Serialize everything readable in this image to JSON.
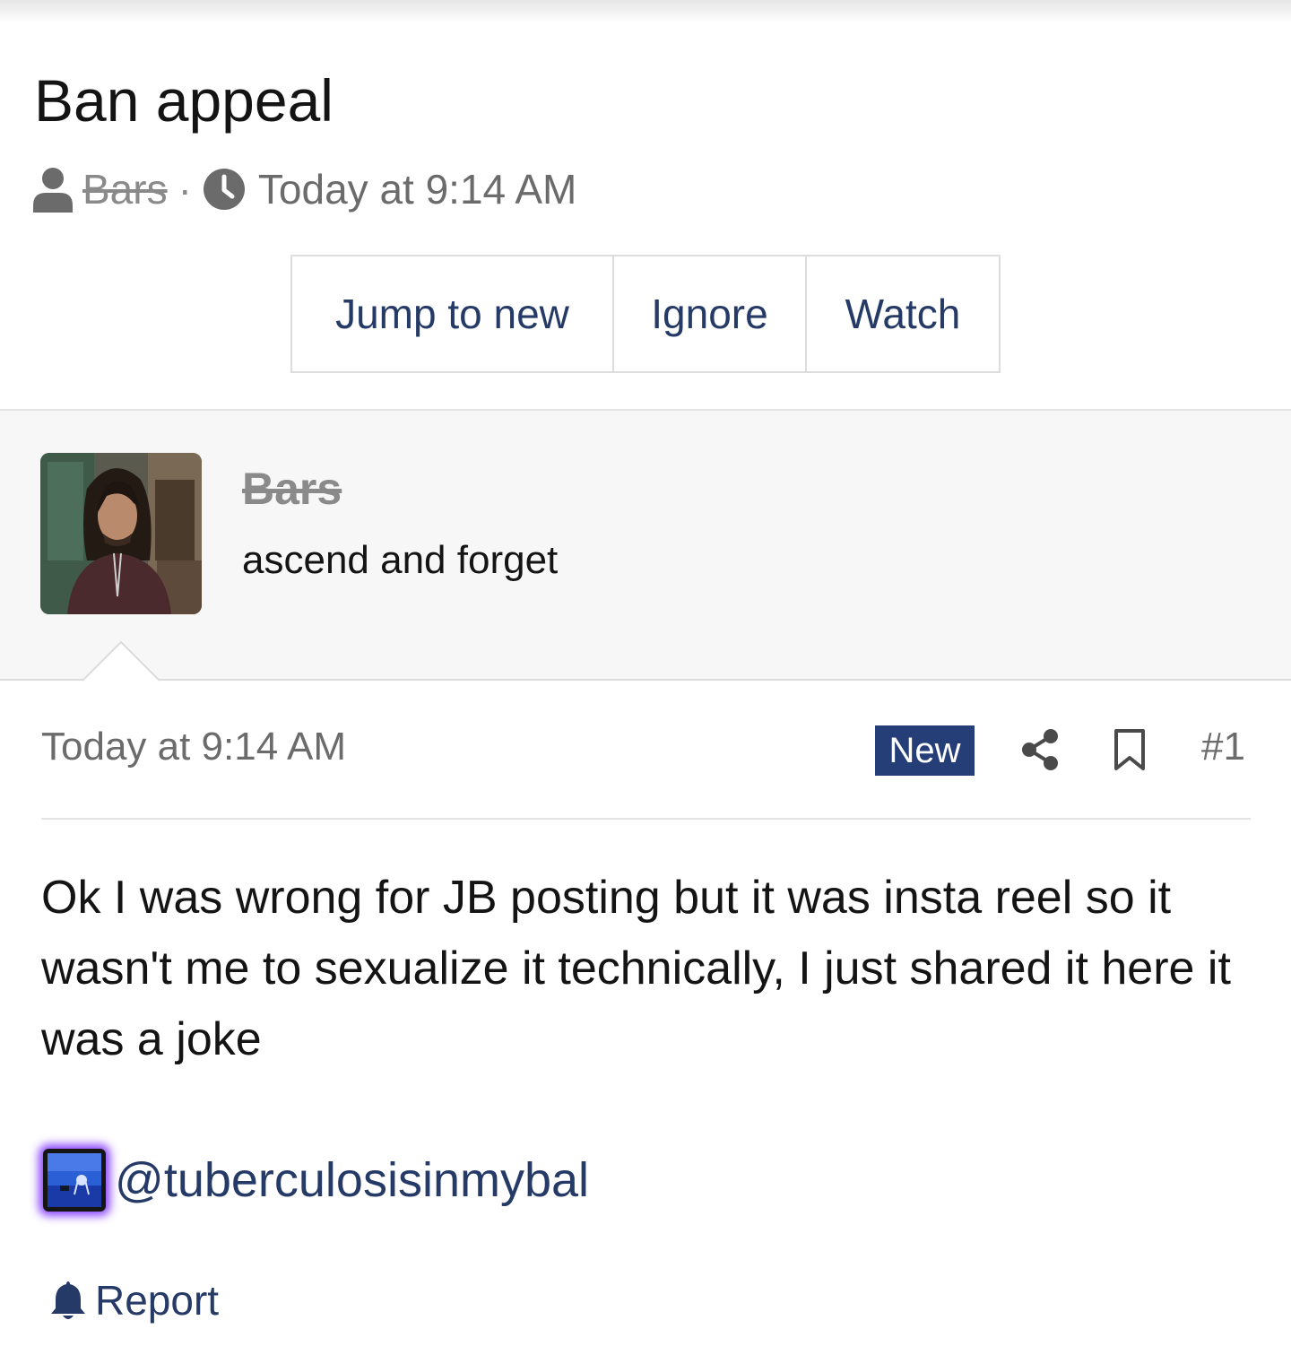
{
  "thread": {
    "title": "Ban appeal",
    "author": "Bars",
    "separator": "·",
    "timestamp": "Today at 9:14 AM"
  },
  "actions": {
    "jump_to_new": "Jump to new",
    "ignore": "Ignore",
    "watch": "Watch"
  },
  "poster": {
    "name": "Bars",
    "user_title": "ascend and forget"
  },
  "post": {
    "date": "Today at 9:14 AM",
    "badge": "New",
    "number": "#1",
    "body": "Ok I was wrong for JB posting but it was insta reel so it wasn't me to sexualize it technically, I just shared it here it was a joke",
    "mention": "@tuberculosisinmybal",
    "report_label": "Report"
  },
  "icons": {
    "user": "user-icon",
    "clock": "clock-icon",
    "share": "share-icon",
    "bookmark": "bookmark-icon",
    "bell": "bell-icon"
  },
  "colors": {
    "link": "#253a66",
    "badge_bg": "#253e78",
    "muted": "#6b6b6b",
    "mention_glow": "#7828ff"
  }
}
